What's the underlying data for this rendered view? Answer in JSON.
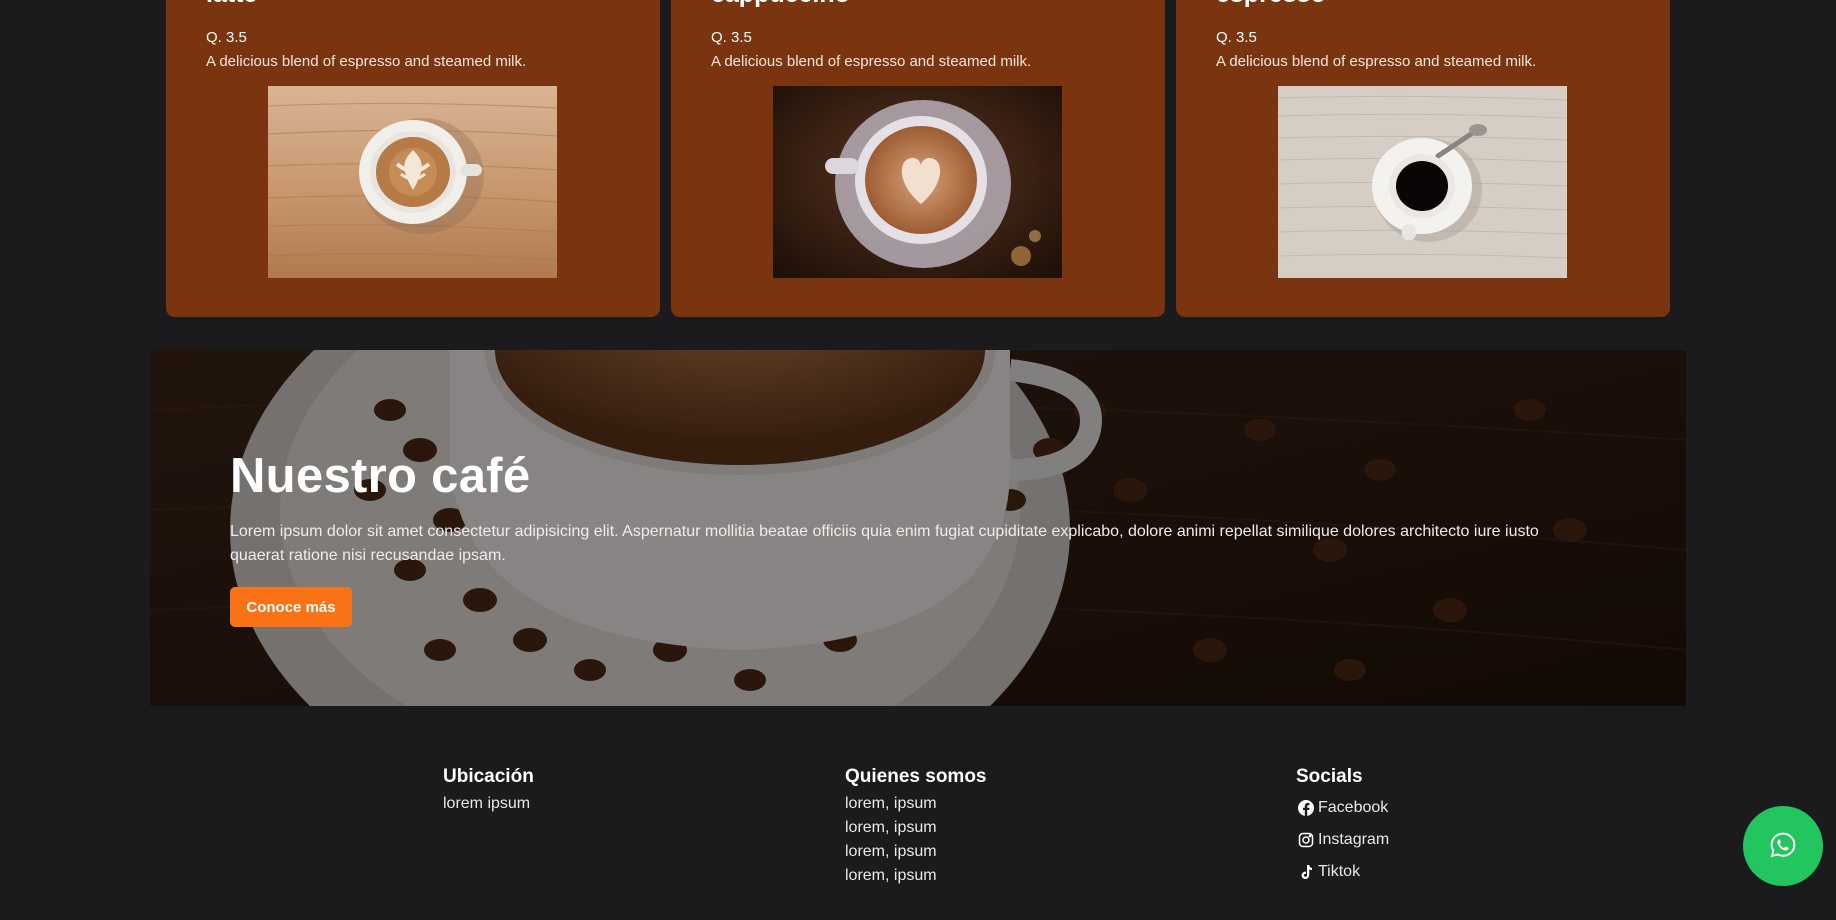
{
  "products": [
    {
      "name": "latte",
      "price": "Q. 3.5",
      "description": "A delicious blend of espresso and steamed milk."
    },
    {
      "name": "cappuccino",
      "price": "Q. 3.5",
      "description": "A delicious blend of espresso and steamed milk."
    },
    {
      "name": "espresso",
      "price": "Q. 3.5",
      "description": "A delicious blend of espresso and steamed milk."
    }
  ],
  "hero": {
    "title": "Nuestro café",
    "text": "Lorem ipsum dolor sit amet consectetur adipisicing elit. Aspernatur mollitia beatae officiis quia enim fugiat cupiditate explicabo, dolore animi repellat similique dolores architecto iure iusto quaerat ratione nisi recusandae ipsam.",
    "button_label": "Conoce más"
  },
  "footer": {
    "location": {
      "heading": "Ubicación",
      "lines": [
        "lorem ipsum"
      ]
    },
    "about": {
      "heading": "Quienes somos",
      "lines": [
        "lorem, ipsum",
        "lorem, ipsum",
        "lorem, ipsum",
        "lorem, ipsum"
      ]
    },
    "socials": {
      "heading": "Socials",
      "links": [
        {
          "label": "Facebook",
          "icon": "facebook-icon"
        },
        {
          "label": "Instagram",
          "icon": "instagram-icon"
        },
        {
          "label": "Tiktok",
          "icon": "tiktok-icon"
        }
      ]
    }
  },
  "whatsapp": {
    "icon": "whatsapp-icon"
  },
  "colors": {
    "page_bg": "#1b1b1d",
    "card_bg": "#7a3410",
    "accent": "#f97316",
    "whatsapp": "#22c55e"
  }
}
